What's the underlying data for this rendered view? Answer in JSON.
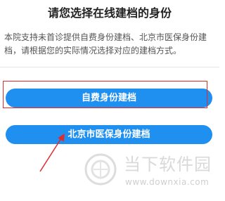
{
  "page": {
    "title": "请您选择在线建档的身份",
    "description": "本院支持未首诊提供自费身份建档、北京市医保身份建档，请根据您的实际情况选择对应的建档方式。"
  },
  "options": {
    "self_pay_label": "自费身份建档",
    "insurance_label": "北京市医保身份建档"
  },
  "watermark": {
    "name": "当下软件园",
    "url": "www.downxia.com"
  },
  "colors": {
    "button": "#1f8ff0",
    "highlight": "#e32a2a"
  }
}
